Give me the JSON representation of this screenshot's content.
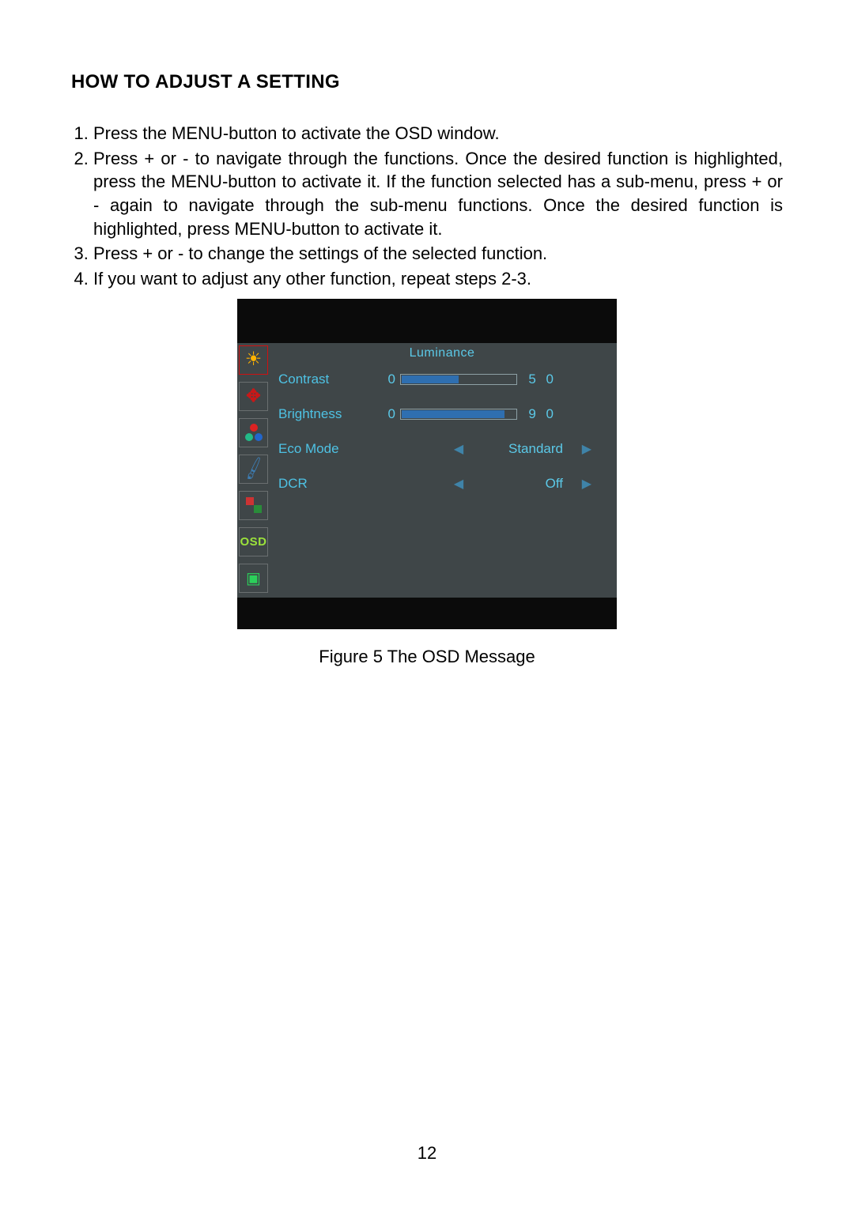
{
  "heading": "HOW TO ADJUST A SETTING",
  "instructions": [
    "Press the MENU-button to activate the OSD window.",
    "Press + or - to navigate through the functions. Once the desired function is highlighted, press the MENU-button  to activate it.  If the function selected has a sub-menu, press + or - again to navigate through the sub-menu functions.  Once the desired function is highlighted, press MENU-button to activate it.",
    "Press + or - to change the settings of the selected function.",
    "If you want to adjust any other function, repeat steps 2-3."
  ],
  "osd": {
    "title": "Luminance",
    "rows": {
      "contrast": {
        "label": "Contrast",
        "min": "0",
        "value": "5 0",
        "fillPercent": 50
      },
      "brightness": {
        "label": "Brightness",
        "min": "0",
        "value": "9 0",
        "fillPercent": 90
      },
      "eco": {
        "label": "Eco Mode",
        "value": "Standard"
      },
      "dcr": {
        "label": "DCR",
        "value": "Off"
      }
    },
    "sidebar_icons": [
      "luminance",
      "image-setup",
      "color-temp",
      "picture-boost",
      "osd-setup",
      "osd",
      "extra"
    ]
  },
  "figure_caption": "Figure 5    The  OSD  Message",
  "page_number": "12"
}
